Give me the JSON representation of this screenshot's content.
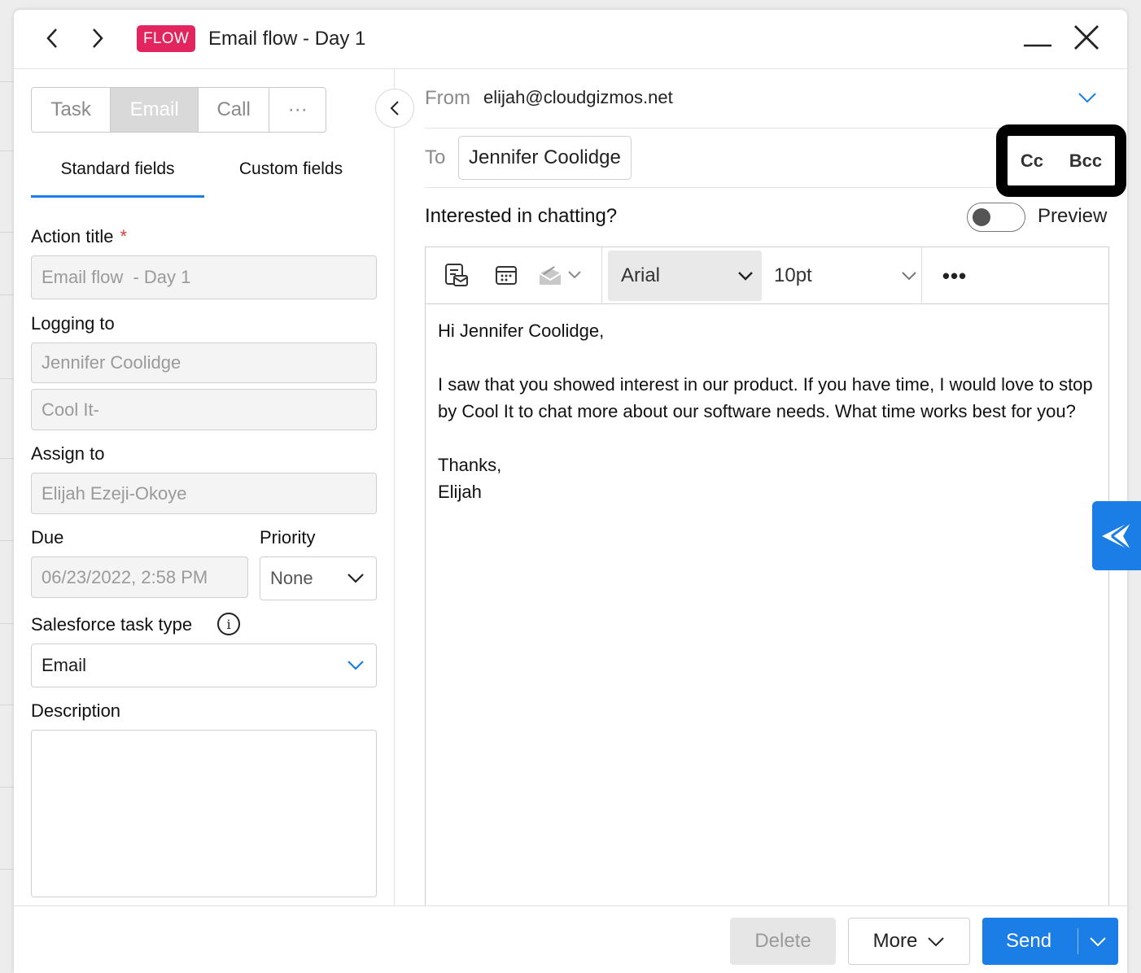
{
  "header": {
    "badge": "FLOW",
    "title": "Email flow - Day 1"
  },
  "left": {
    "segments": [
      "Task",
      "Email",
      "Call",
      "···"
    ],
    "active_segment": "Email",
    "subtabs": [
      "Standard fields",
      "Custom fields"
    ],
    "action_title_label": "Action title",
    "required_mark": "*",
    "action_title_value": "Email flow  - Day 1",
    "logging_to_label": "Logging to",
    "logging_to_contact": "Jennifer Coolidge",
    "logging_to_account": "Cool It-",
    "assign_to_label": "Assign to",
    "assign_to_value": "Elijah Ezeji-Okoye",
    "due_label": "Due",
    "due_value": "06/23/2022, 2:58 PM",
    "priority_label": "Priority",
    "priority_value": "None",
    "task_type_label": "Salesforce task type",
    "task_type_value": "Email",
    "description_label": "Description",
    "description_value": ""
  },
  "email": {
    "from_label": "From",
    "from_value": "elijah@cloudgizmos.net",
    "to_label": "To",
    "to_value": "Jennifer Coolidge",
    "cc_label": "Cc",
    "bcc_label": "Bcc",
    "subject": "Interested in chatting?",
    "preview_label": "Preview",
    "preview_on": false,
    "font": "Arial",
    "font_size": "10pt",
    "more_tools": "•••",
    "body": {
      "greeting": "Hi Jennifer Coolidge,",
      "paragraph": "I saw that you showed interest in our product. If you have time, I would love to stop by Cool It to chat more about our software needs. What time works best for you?",
      "signoff": "Thanks,",
      "signature": "Elijah"
    }
  },
  "footer": {
    "delete_label": "Delete",
    "more_label": "More",
    "send_label": "Send"
  },
  "colors": {
    "accent": "#1a7ee6",
    "flow_badge": "#e2245f",
    "required": "#d93b3b"
  }
}
